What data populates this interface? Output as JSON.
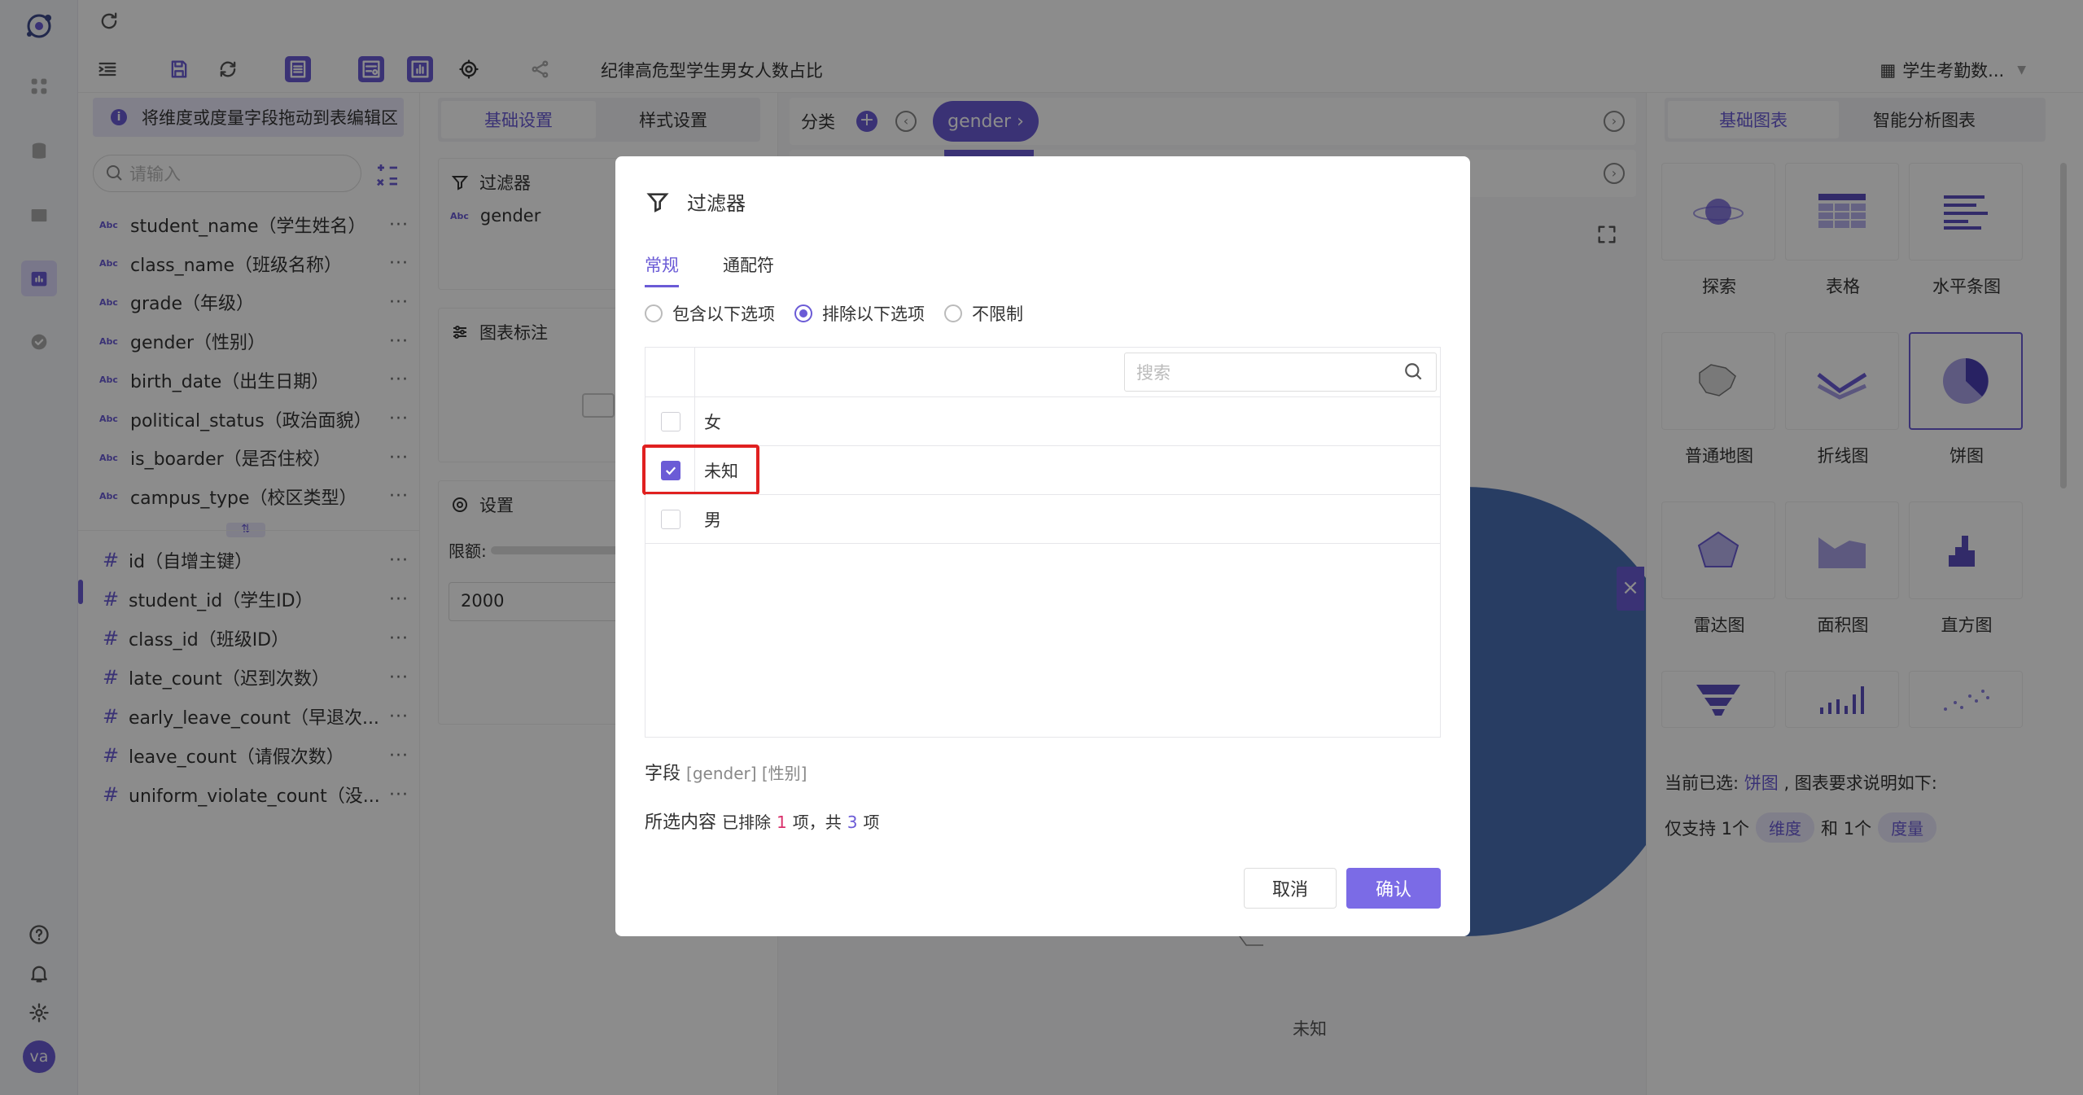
{
  "topbar": {
    "refresh_icon": "refresh-icon"
  },
  "toolbar": {
    "title": "纪律高危型学生男女人数占比",
    "dataset": "学生考勤数...",
    "icons": [
      "indent-icon",
      "save-icon",
      "refresh-icon",
      "table-icon",
      "form-icon",
      "chart-icon",
      "settings-icon",
      "share-icon"
    ]
  },
  "rail": {
    "user_initials": "va"
  },
  "fields_panel": {
    "hint": "将维度或度量字段拖动到表编辑区",
    "search_placeholder": "请输入",
    "dimension_tag": "Abc",
    "measure_tag": "#",
    "more": "···",
    "dimensions": [
      "student_name（学生姓名）",
      "class_name（班级名称）",
      "grade（年级）",
      "gender（性别）",
      "birth_date（出生日期）",
      "political_status（政治面貌）",
      "is_boarder（是否住校）",
      "campus_type（校区类型）"
    ],
    "measures": [
      "id（自增主键）",
      "student_id（学生ID）",
      "class_id（班级ID）",
      "late_count（迟到次数）",
      "early_leave_count（早退次...",
      "leave_count（请假次数）",
      "uniform_violate_count（没..."
    ]
  },
  "settings_panel": {
    "tabs": [
      "基础设置",
      "样式设置"
    ],
    "filter_title": "过滤器",
    "filter_field": "gender",
    "filter_field_tag": "Abc",
    "annotation_title": "图表标注",
    "settings_title": "设置",
    "limit_label": "限额:",
    "limit_value": "2000"
  },
  "canvas": {
    "category_label": "分类",
    "gender_chip": "gender ›",
    "pie_label": "未知"
  },
  "right_panel": {
    "tabs": [
      "基础图表",
      "智能分析图表"
    ],
    "charts": [
      "探索",
      "表格",
      "水平条图",
      "普通地图",
      "折线图",
      "饼图",
      "雷达图",
      "面积图",
      "直方图"
    ],
    "current_label": "当前已选:",
    "current_chart": "饼图",
    "requirement": ", 图表要求说明如下:",
    "only_support": "仅支持 1个",
    "dimension_pill": "维度",
    "and_one": "和 1个",
    "measure_pill": "度量"
  },
  "modal": {
    "title": "过滤器",
    "tabs": [
      "常规",
      "通配符"
    ],
    "radios": [
      "包含以下选项",
      "排除以下选项",
      "不限制"
    ],
    "selected_radio": 1,
    "search_placeholder": "搜索",
    "options": [
      {
        "label": "女",
        "checked": false
      },
      {
        "label": "未知",
        "checked": true
      },
      {
        "label": "男",
        "checked": false
      }
    ],
    "field_label": "字段",
    "field_value": "[gender] [性别]",
    "selection_label": "所选内容",
    "excluded_prefix": "已排除",
    "excluded_count": "1",
    "excluded_mid": "项，共",
    "total_count": "3",
    "total_suffix": "项",
    "cancel": "取消",
    "confirm": "确认"
  },
  "colors": {
    "accent": "#6b5bd6",
    "pie": "#4a6fb5",
    "highlight": "#e02020"
  }
}
